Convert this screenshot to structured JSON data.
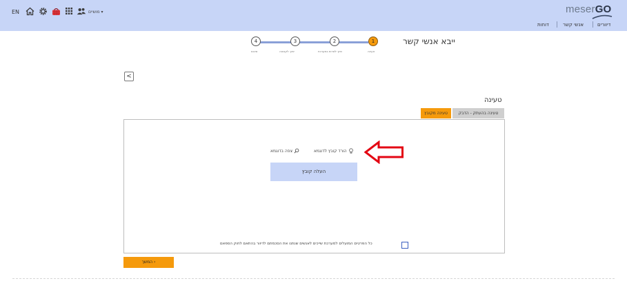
{
  "header": {
    "language": "EN",
    "icons": [
      "home-icon",
      "gear-icon",
      "basket-icon",
      "apps-grid-icon",
      "users-icon"
    ],
    "account_label": "מושיים ▾",
    "logo_text_light": "meser",
    "logo_text_bold": "GO",
    "nav": [
      "דיוורים",
      "אנשי קשר",
      "דוחות"
    ]
  },
  "wizard": {
    "title": "ייבא אנשי קשר",
    "steps": [
      {
        "number": "1",
        "label": "טעינה",
        "active": true
      },
      {
        "number": "2",
        "label": "שיוך לשדות במערכת"
      },
      {
        "number": "3",
        "label": "שיוך לקבוצה"
      },
      {
        "number": "4",
        "label": "סיכום"
      }
    ]
  },
  "back_button": "<",
  "section_title": "טעינה",
  "tabs": {
    "file": "טעינה מקובץ",
    "paste": "טעינה בהעתק - הדבק"
  },
  "upload": {
    "download_sample": "הורד קובץ לדוגמא",
    "view_sample": "צפה בדוגמא",
    "upload_button": "העלה קובץ"
  },
  "consent_text": "כל הפרטים המועלים למערכת שייכים לאנשים שנתנו את הסכמתם לדיוור בהתאם לחוק הספאם",
  "continue_button": "המשך  ›",
  "colors": {
    "header_bg": "#c7d5f7",
    "accent_orange": "#f59a0c",
    "annotation_arrow": "#e30613"
  }
}
